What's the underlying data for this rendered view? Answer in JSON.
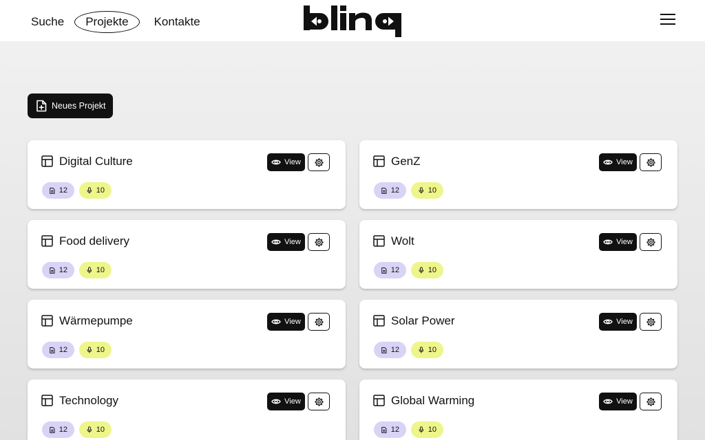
{
  "header": {
    "nav": [
      {
        "label": "Suche",
        "active": false
      },
      {
        "label": "Projekte",
        "active": true
      },
      {
        "label": "Kontakte",
        "active": false
      }
    ],
    "logo_text": "bling",
    "menu_icon": "hamburger-icon"
  },
  "actions": {
    "new_project_label": "Neues Projekt",
    "new_project_icon": "file-plus-icon"
  },
  "colors": {
    "doc_badge": "#d9d3f6",
    "mic_badge": "#eef58a",
    "button_dark": "#111111"
  },
  "projects": [
    {
      "title": "Digital Culture",
      "view_label": "View",
      "docs": "12",
      "audio": "10"
    },
    {
      "title": "GenZ",
      "view_label": "View",
      "docs": "12",
      "audio": "10"
    },
    {
      "title": "Food delivery",
      "view_label": "View",
      "docs": "12",
      "audio": "10"
    },
    {
      "title": "Wolt",
      "view_label": "View",
      "docs": "12",
      "audio": "10"
    },
    {
      "title": "Wärmepumpe",
      "view_label": "View",
      "docs": "12",
      "audio": "10"
    },
    {
      "title": "Solar Power",
      "view_label": "View",
      "docs": "12",
      "audio": "10"
    },
    {
      "title": "Technology",
      "view_label": "View",
      "docs": "12",
      "audio": "10"
    },
    {
      "title": "Global Warming",
      "view_label": "View",
      "docs": "12",
      "audio": "10"
    }
  ]
}
